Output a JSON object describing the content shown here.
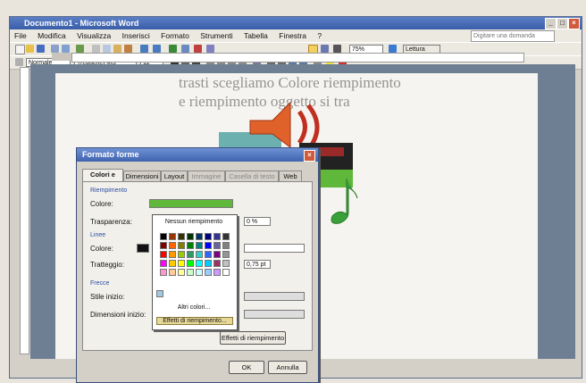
{
  "window": {
    "title": "Documento1 - Microsoft Word",
    "help_placeholder": "Digitare una domanda",
    "min": "_",
    "max": "□",
    "close": "×"
  },
  "menu": [
    "File",
    "Modifica",
    "Visualizza",
    "Inserisci",
    "Formato",
    "Strumenti",
    "Tabella",
    "Finestra",
    "?"
  ],
  "toolbar": {
    "style": "Normale",
    "font": "Trebuchet MS",
    "size": "12",
    "zoom": "75%",
    "read": "Lettura"
  },
  "document": {
    "line1": "trasti scegliamo Colore riempimento",
    "line2": "e riempimento oggetto si tra"
  },
  "dialog": {
    "title": "Formato forme",
    "close": "×",
    "tabs": [
      "Colori e linee",
      "Dimensioni",
      "Layout",
      "Immagine",
      "Casella di testo",
      "Web"
    ],
    "fill_section": "Riempimento",
    "color_label": "Colore:",
    "transparency_label": "Trasparenza:",
    "transparency_value": "0 %",
    "lines_section": "Linee",
    "line_color_label": "Colore:",
    "dash_label": "Tratteggio:",
    "weight_value": "0,75 pt",
    "arrows_section": "Frecce",
    "begin_style_label": "Stile inizio:",
    "begin_size_label": "Dimensioni inizio:",
    "fill_effects_button": "Effetti di riempimento",
    "ok": "OK",
    "cancel": "Annulla"
  },
  "popup": {
    "no_fill": "Nessun riempimento",
    "more_colors": "Altri colori...",
    "fill_effects": "Effetti di riempimento..."
  },
  "swatch_colors": [
    "#000000",
    "#993300",
    "#333300",
    "#003300",
    "#003366",
    "#000080",
    "#333399",
    "#333333",
    "#800000",
    "#ff6600",
    "#808000",
    "#008000",
    "#008080",
    "#0000ff",
    "#666699",
    "#808080",
    "#ff0000",
    "#ff9900",
    "#99cc00",
    "#339966",
    "#33cccc",
    "#3366ff",
    "#800080",
    "#969696",
    "#ff00ff",
    "#ffcc00",
    "#ffff00",
    "#00ff00",
    "#00ffff",
    "#00ccff",
    "#993366",
    "#c0c0c0",
    "#ff99cc",
    "#ffcc99",
    "#ffff99",
    "#ccffcc",
    "#ccffff",
    "#99ccff",
    "#cc99ff",
    "#ffffff"
  ],
  "colors": {
    "fill_green": "#5fb83a",
    "speaker": "#e0622a",
    "title_blue": "#3f63ae"
  }
}
